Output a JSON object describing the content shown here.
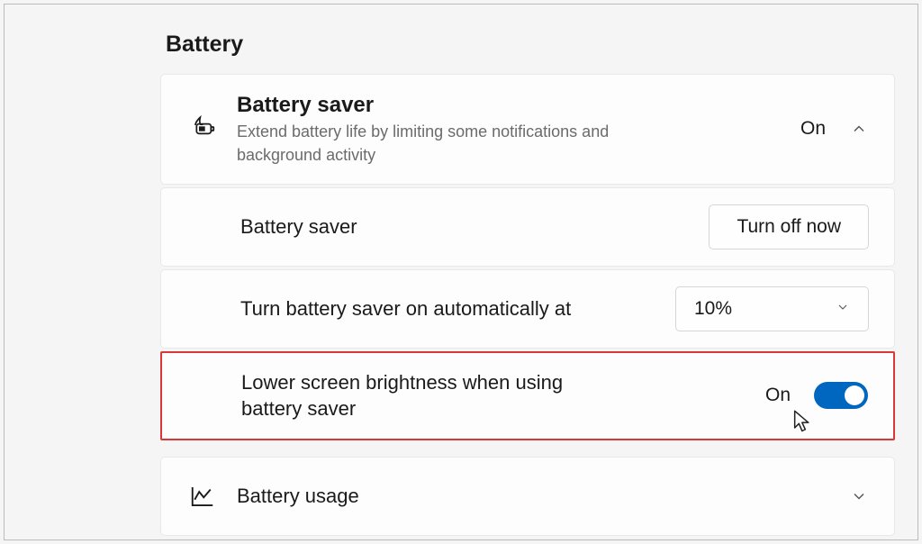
{
  "section": {
    "title": "Battery"
  },
  "battery_saver_header": {
    "title": "Battery saver",
    "description": "Extend battery life by limiting some notifications and background activity",
    "state": "On"
  },
  "rows": {
    "battery_saver_toggle_row": {
      "label": "Battery saver",
      "button": "Turn off now"
    },
    "auto_on_row": {
      "label": "Turn battery saver on automatically at",
      "value": "10%"
    },
    "brightness_row": {
      "label": "Lower screen brightness when using battery saver",
      "state": "On",
      "highlighted": true,
      "toggle_on": true
    }
  },
  "battery_usage": {
    "title": "Battery usage"
  }
}
